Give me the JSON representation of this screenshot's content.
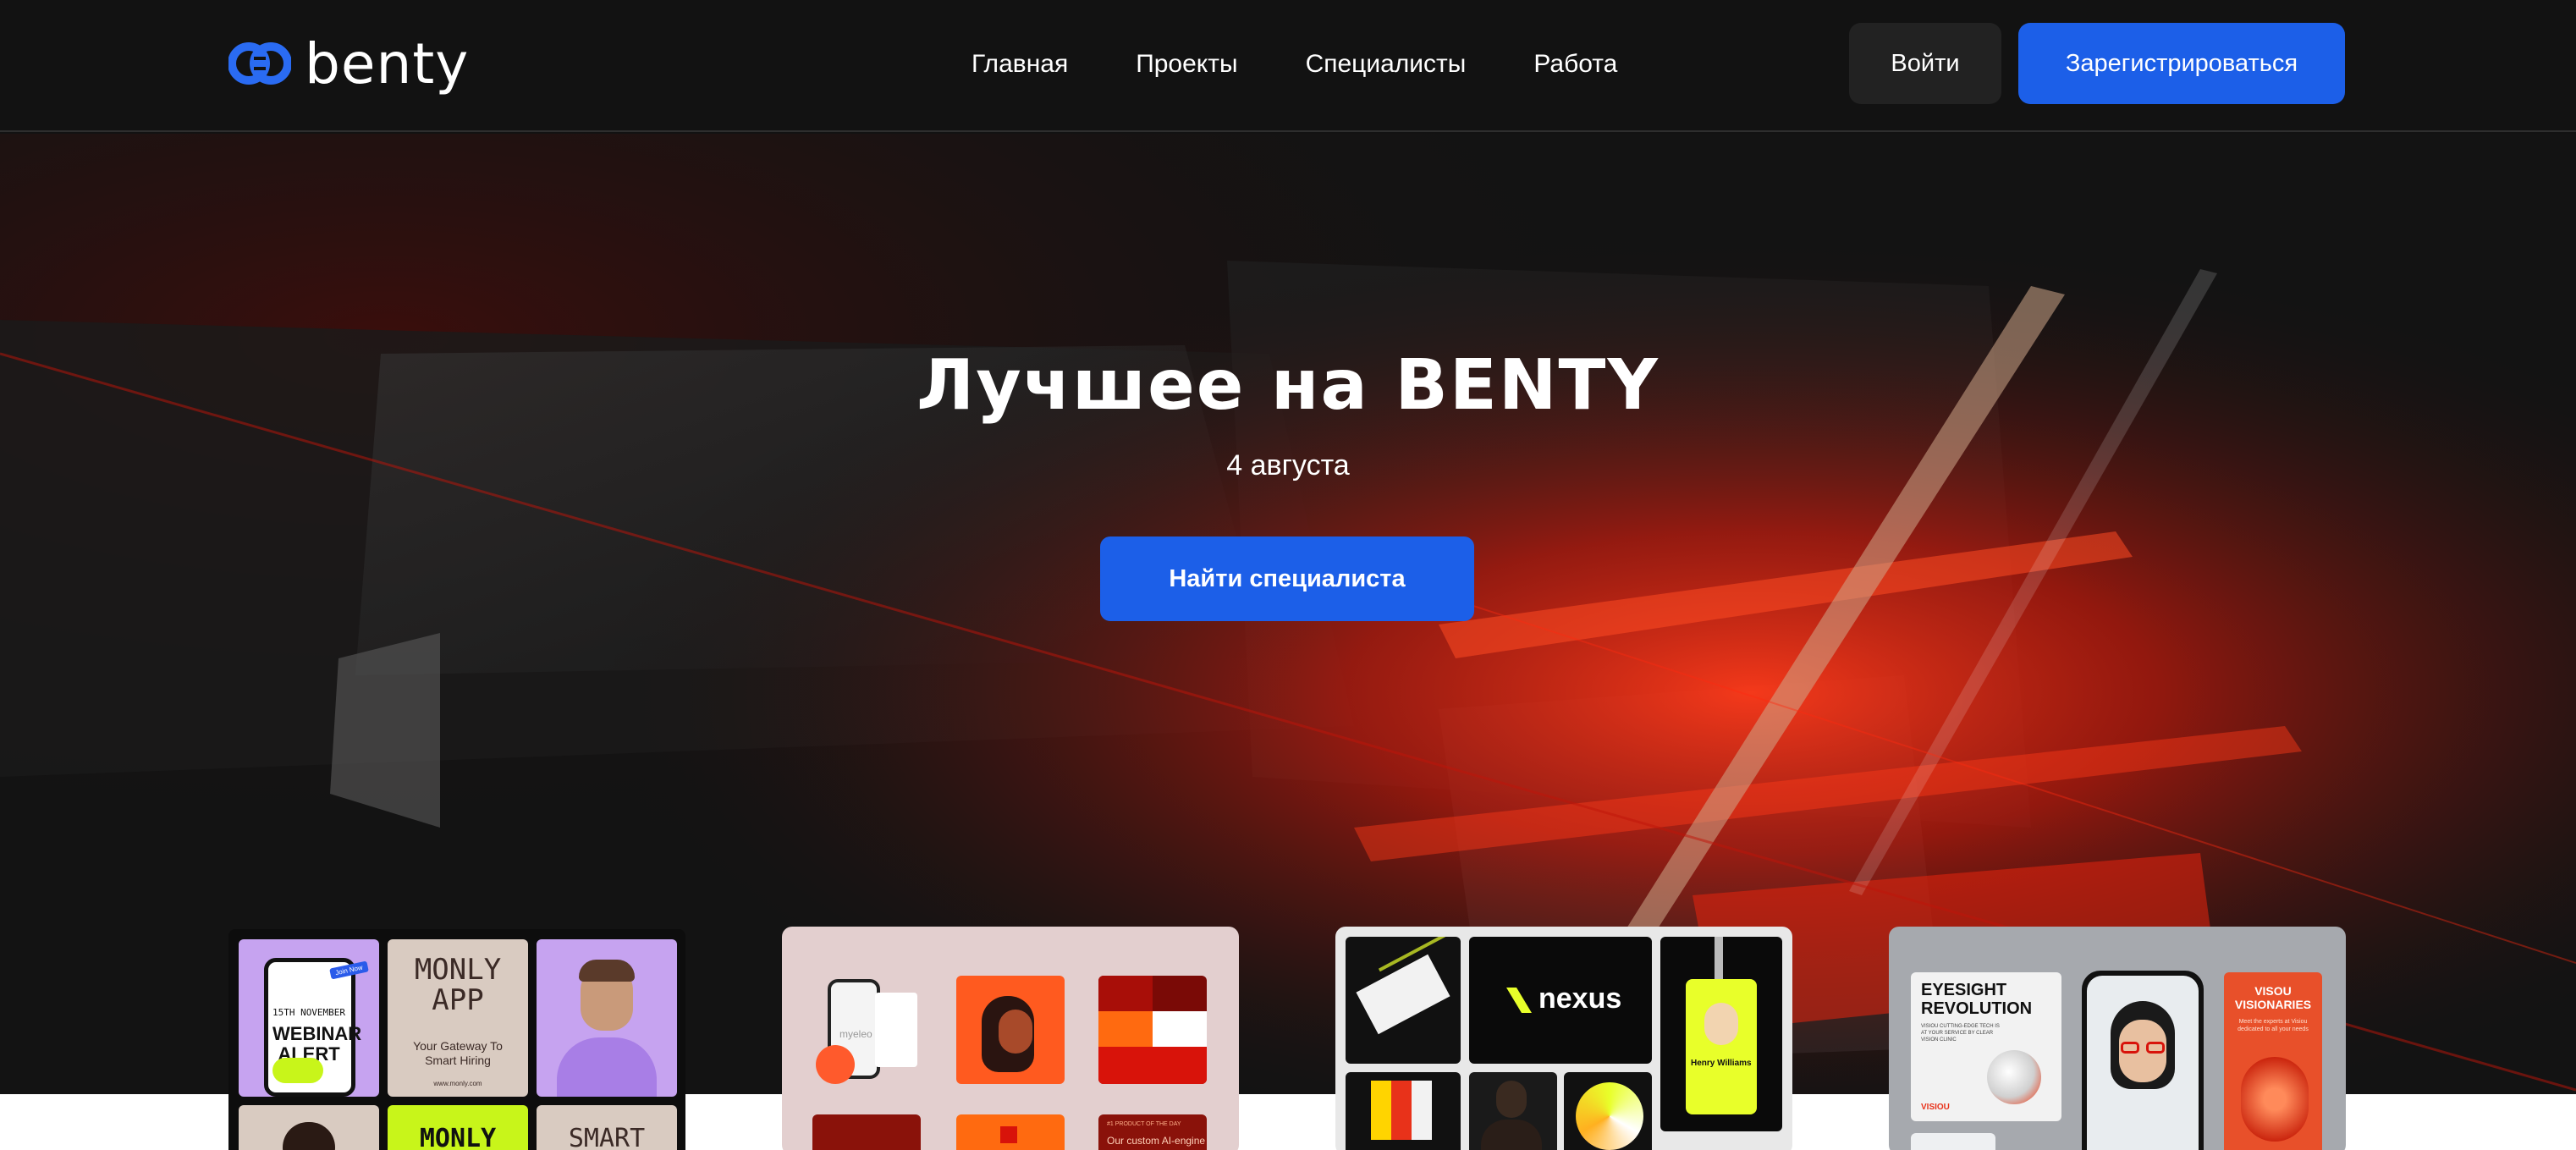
{
  "header": {
    "logo_text": "benty",
    "nav": [
      "Главная",
      "Проекты",
      "Специалисты",
      "Работа"
    ],
    "login_label": "Войти",
    "register_label": "Зарегистрироваться"
  },
  "hero": {
    "title": "Лучшее на BENTY",
    "date": "4 августа",
    "cta_label": "Найти специалиста"
  },
  "cards": {
    "card1": {
      "webinar_line1": "15TH NOVEMBER",
      "webinar_title": "WEBINAR ALERT",
      "badge": "Join Now",
      "app_title": "MONLY APP",
      "app_tagline": "Your Gateway To Smart Hiring",
      "app_url": "www.monly.com",
      "bottom_mid": "MONLY",
      "bottom_right": "SMART"
    },
    "card2": {
      "phone_text": "myeleo",
      "product_label": "#1 PRODUCT OF THE DAY",
      "engine_text": "Our custom AI-engine"
    },
    "card3": {
      "brand": "nexus",
      "badge_name": "Henry Williams"
    },
    "card4": {
      "headline": "EYESIGHT REVOLUTION",
      "subtext": "VISIOU CUTTING-EDGE TECH IS AT YOUR SERVICE BY CLEAR VISION CLINIC",
      "logo": "VISIOU",
      "side_title": "VISOU VISIONARIES",
      "side_text": "Meet the experts at Visiou dedicated to all your needs"
    }
  },
  "colors": {
    "accent": "#1c5fe8",
    "background": "#121212",
    "hero_red": "#d8200f"
  }
}
